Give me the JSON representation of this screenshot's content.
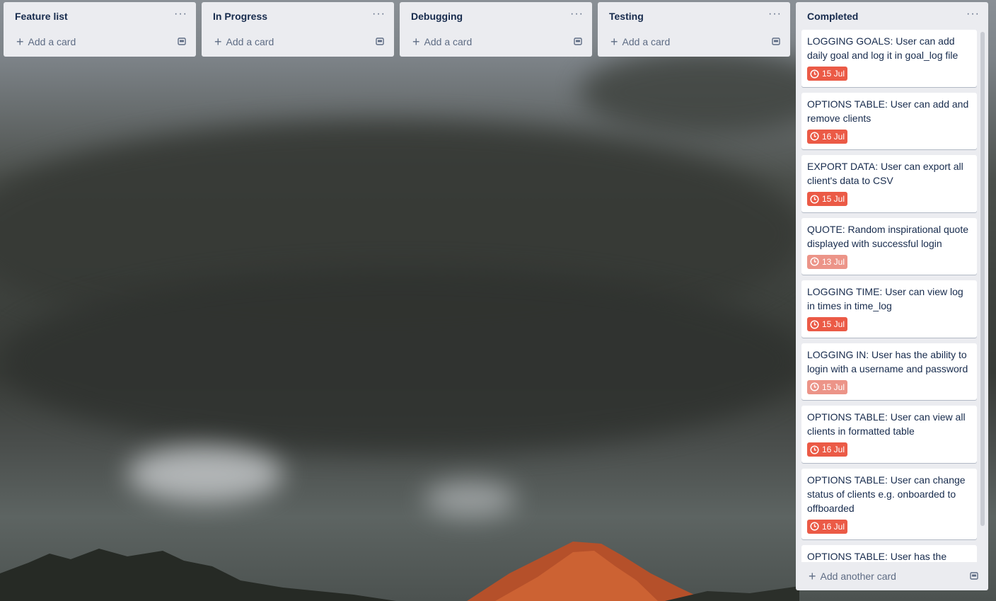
{
  "lists": [
    {
      "title": "Feature list",
      "add_label": "Add a card"
    },
    {
      "title": "In Progress",
      "add_label": "Add a card"
    },
    {
      "title": "Debugging",
      "add_label": "Add a card"
    },
    {
      "title": "Testing",
      "add_label": "Add a card"
    }
  ],
  "completed": {
    "title": "Completed",
    "add_label": "Add another card",
    "cards": [
      {
        "text": "LOGGING GOALS: User can add daily goal and log it in goal_log file",
        "due": "15 Jul",
        "due_color": "#eb5a46"
      },
      {
        "text": "OPTIONS TABLE: User can add and remove clients",
        "due": "16 Jul",
        "due_color": "#eb5a46"
      },
      {
        "text": "EXPORT DATA: User can export all client's data to CSV",
        "due": "15 Jul",
        "due_color": "#eb5a46"
      },
      {
        "text": "QUOTE: Random inspirational quote displayed with successful login",
        "due": "13 Jul",
        "due_color": "#ec9488"
      },
      {
        "text": "LOGGING TIME: User can view log in times in time_log",
        "due": "15 Jul",
        "due_color": "#eb5a46"
      },
      {
        "text": "LOGGING IN: User has the ability to login with a username and password",
        "due": "15 Jul",
        "due_color": "#ec9488"
      },
      {
        "text": "OPTIONS TABLE: User can view all clients in formatted table",
        "due": "16 Jul",
        "due_color": "#eb5a46"
      },
      {
        "text": "OPTIONS TABLE: User can change status of clients e.g. onboarded to offboarded",
        "due": "16 Jul",
        "due_color": "#eb5a46"
      },
      {
        "text": "OPTIONS TABLE: User has the ability",
        "due": "",
        "due_color": "#eb5a46"
      }
    ]
  },
  "icons": {
    "menu": "more-horizontal-icon",
    "add": "plus-icon",
    "template": "card-template-icon",
    "due": "clock-icon"
  }
}
